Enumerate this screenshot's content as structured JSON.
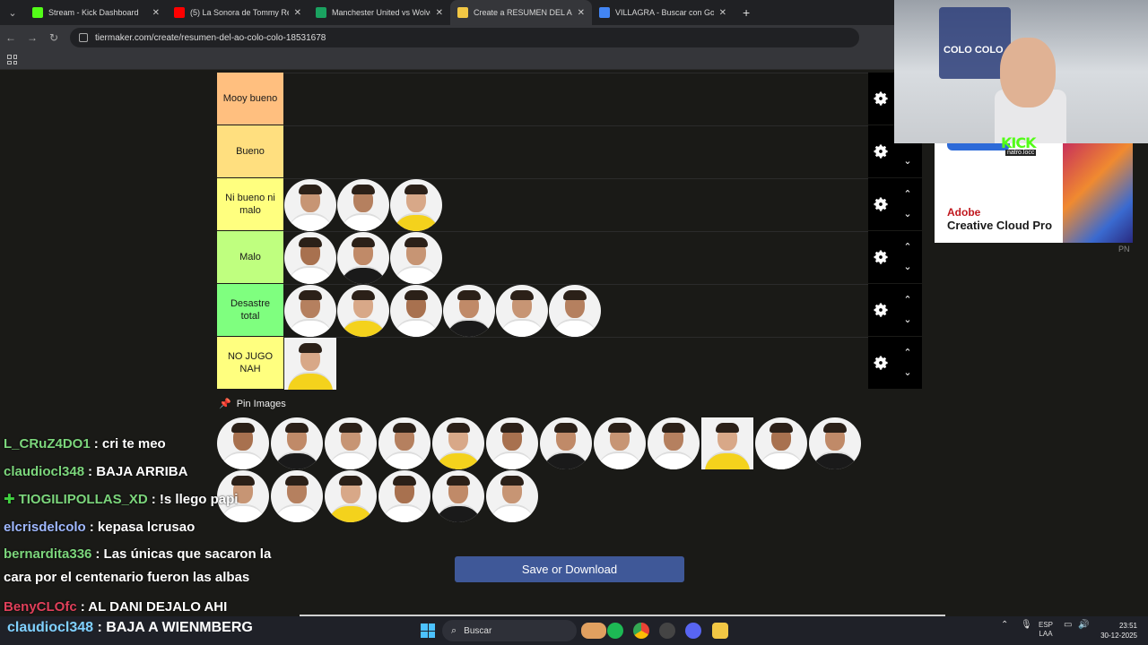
{
  "browser": {
    "tabs": [
      {
        "title": "Stream - Kick Dashboard",
        "icon_color": "#53fc18",
        "active": false
      },
      {
        "title": "(5) La Sonora de Tommy Rey - L",
        "icon_color": "#ff0000",
        "active": false
      },
      {
        "title": "Manchester United vs Wolverha",
        "icon_color": "#1aa260",
        "active": false
      },
      {
        "title": "Create a RESUMEN DEL AÑO C",
        "icon_color": "#f2c744",
        "active": true
      },
      {
        "title": "VILLAGRA - Buscar con Google",
        "icon_color": "#4285f4",
        "active": false
      }
    ],
    "url": "tiermaker.com/create/resumen-del-ao-colo-colo-18531678"
  },
  "tiers": [
    {
      "label": "Mooy bueno",
      "color": "#ffbf7f",
      "count": 0
    },
    {
      "label": "Bueno",
      "color": "#ffdf7f",
      "count": 0
    },
    {
      "label": "Ni bueno ni malo",
      "color": "#ffff7f",
      "count": 3
    },
    {
      "label": "Malo",
      "color": "#bfff7f",
      "count": 3
    },
    {
      "label": "Desastre total",
      "color": "#7fff7f",
      "count": 6
    },
    {
      "label": "NO JUGO NAH",
      "color": "#ffff7f",
      "count": 1
    }
  ],
  "pin_images_label": "Pin Images",
  "pool_count": 18,
  "save_button": "Save or Download",
  "ad": {
    "brand": "Adobe",
    "product": "Creative Cloud Pro",
    "corner": "PN"
  },
  "overlay": {
    "kick": "KICK",
    "kick_sub": "natro.locc",
    "banner": "COLO COLO"
  },
  "chat": [
    {
      "user": "L_CRuZ4DO1",
      "color": "#7cd67c",
      "text": ": cri te meo"
    },
    {
      "user": "claudiocl348",
      "color": "#7cd67c",
      "text": ": BAJA ARRIBA"
    },
    {
      "user": "TIOGILIPOLLAS_XD",
      "color": "#7cd67c",
      "text": ": !s llego papi"
    },
    {
      "user": "elcrisdelcolo",
      "color": "#9fb8ff",
      "text": ": kepasa lcrusao"
    },
    {
      "user": "bernardita336",
      "color": "#7cd67c",
      "text": ": Las únicas que sacaron la cara por el centenario fueron las albas"
    },
    {
      "user": "BenyCLOfc",
      "color": "#e0405a",
      "text": ": AL DANI DEJALO AHI"
    }
  ],
  "bottom_chat": {
    "user": "claudiocl348",
    "text": ": BAJA A WIENMBERG"
  },
  "taskbar": {
    "search_placeholder": "Buscar",
    "lang_top": "ESP",
    "lang_bottom": "LAA",
    "time": "23:51",
    "date": "30-12-2025"
  }
}
